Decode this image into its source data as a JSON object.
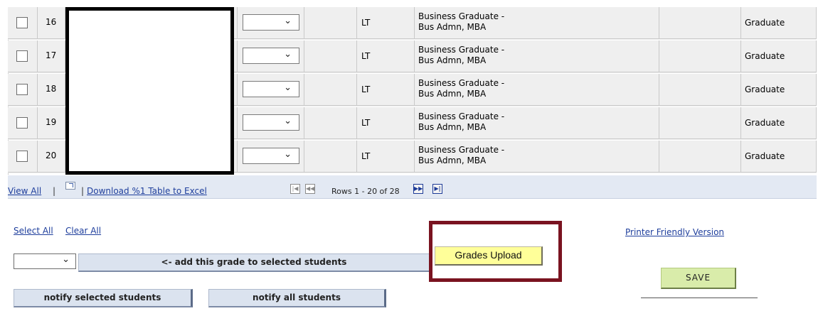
{
  "table": {
    "rows": [
      {
        "num": "16",
        "lt": "LT",
        "program": "Business Graduate -\nBus Admn, MBA",
        "level": "Graduate"
      },
      {
        "num": "17",
        "lt": "LT",
        "program": "Business Graduate -\nBus Admn, MBA",
        "level": "Graduate"
      },
      {
        "num": "18",
        "lt": "LT",
        "program": "Business Graduate -\nBus Admn, MBA",
        "level": "Graduate"
      },
      {
        "num": "19",
        "lt": "LT",
        "program": "Business Graduate -\nBus Admn, MBA",
        "level": "Graduate"
      },
      {
        "num": "20",
        "lt": "LT",
        "program": "Business Graduate -\nBus Admn, MBA",
        "level": "Graduate"
      }
    ]
  },
  "nav": {
    "view_all": "View All",
    "download": "Download %1 Table to Excel",
    "rows_text": "Rows 1 - 20 of 28"
  },
  "actions": {
    "select_all": "Select All",
    "clear_all": "Clear All",
    "add_grade": "<- add this grade to selected students",
    "notify_selected": "notify selected students",
    "notify_all": "notify all students",
    "grades_upload": "Grades Upload",
    "printer_friendly": "Printer Friendly Version",
    "save": "SAVE"
  },
  "colors": {
    "link": "#1e3e9c",
    "highlight_box": "#7a1320",
    "upload_button": "#ffff99",
    "save_button": "#d9ecaa"
  }
}
